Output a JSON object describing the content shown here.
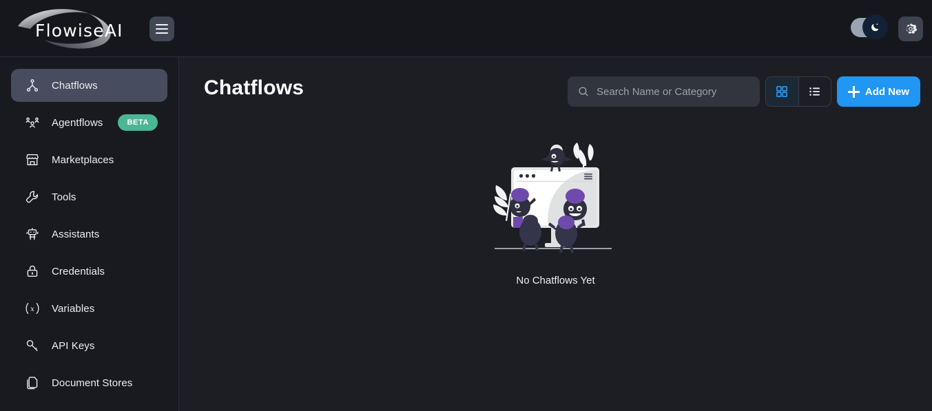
{
  "header": {
    "logo_text": "FlowiseAI",
    "menu_toggle_name": "menu-icon",
    "theme_toggle": {
      "state": "dark",
      "icon": "moon-icon"
    },
    "settings_icon": "gear-icon"
  },
  "sidebar": {
    "items": [
      {
        "label": "Chatflows",
        "icon": "chatflow-icon",
        "active": true,
        "badge": ""
      },
      {
        "label": "Agentflows",
        "icon": "agentflow-icon",
        "active": false,
        "badge": "BETA"
      },
      {
        "label": "Marketplaces",
        "icon": "marketplace-icon",
        "active": false,
        "badge": ""
      },
      {
        "label": "Tools",
        "icon": "wrench-icon",
        "active": false,
        "badge": ""
      },
      {
        "label": "Assistants",
        "icon": "robot-icon",
        "active": false,
        "badge": ""
      },
      {
        "label": "Credentials",
        "icon": "lock-icon",
        "active": false,
        "badge": ""
      },
      {
        "label": "Variables",
        "icon": "variable-icon",
        "active": false,
        "badge": ""
      },
      {
        "label": "API Keys",
        "icon": "key-icon",
        "active": false,
        "badge": ""
      },
      {
        "label": "Document Stores",
        "icon": "documents-icon",
        "active": false,
        "badge": ""
      }
    ]
  },
  "main": {
    "title": "Chatflows",
    "search": {
      "placeholder": "Search Name or Category",
      "value": "",
      "icon": "search-icon"
    },
    "view_toggle": {
      "grid_label": "grid-view-icon",
      "list_label": "list-view-icon",
      "selected": "grid"
    },
    "add_button": {
      "label": "Add New",
      "icon": "plus-icon"
    },
    "empty_state": {
      "caption": "No Chatflows Yet",
      "illustration": "empty-monitor-illustration"
    }
  },
  "colors": {
    "accent_blue": "#2196f3",
    "badge_green": "#4cb594",
    "sidebar_bg": "#191a1f",
    "main_bg": "#1d1e23",
    "header_bg": "#16171c",
    "active_item_bg": "#474c5e",
    "illustration_purple": "#6d4aab",
    "illustration_dark": "#2f2f3f"
  }
}
